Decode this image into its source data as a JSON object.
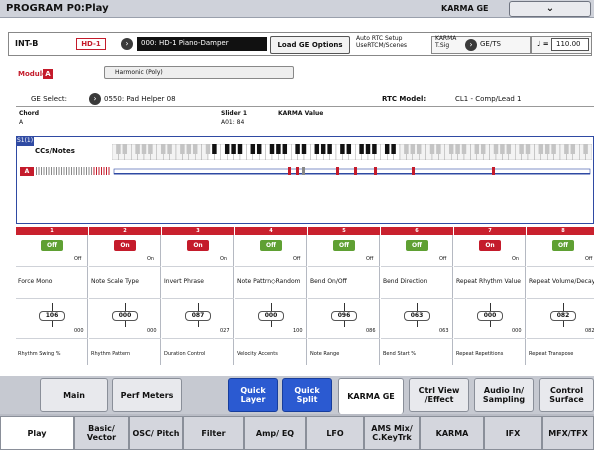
{
  "window": {
    "title": "PROGRAM P0:Play",
    "mode_label": "KARMA GE",
    "menu_icon": "chevron-down"
  },
  "program": {
    "bank": "INT-B",
    "number": "HD-1",
    "name": "000: HD-1 Piano-Damper",
    "load_ge_button": "Load GE Options",
    "rtc_setup_line1": "Auto RTC Setup",
    "rtc_setup_line2": "UseRTCM/Scenes",
    "karma_tsig_line1": "KARMA",
    "karma_tsig_line2": "T.Sig",
    "tsig_value": "GE/TS",
    "tempo_symbol": "♩ =",
    "tempo_value": "110.00"
  },
  "module": {
    "label": "Module",
    "id": "A",
    "harmonic": "Harmonic (Poly)",
    "ge_select_label": "GE Select:",
    "ge_value": "0550: Pad Helper 08",
    "rtc_model_label": "RTC Model:",
    "rtc_model_value": "CL1 - Comp/Lead 1",
    "chord_label": "Chord",
    "chord_value": "A",
    "slider_label": "Slider 1",
    "slider_value": "A01: 84",
    "karma_value_label": "KARMA Value"
  },
  "keyboard": {
    "tag": "S1(1)",
    "ccs_label": "CCs/Notes",
    "track_tag": "A"
  },
  "slots": [
    {
      "num": "1",
      "state": "Off",
      "state_text": "Off",
      "on": false,
      "switch_name": "Force Mono",
      "knob_value": "106",
      "knob_max": "000",
      "knob_name": "Rhythm Swing %"
    },
    {
      "num": "2",
      "state": "On",
      "state_text": "On",
      "on": true,
      "switch_name": "Note Scale Type",
      "knob_value": "000",
      "knob_max": "000",
      "knob_name": "Rhythm Pattern"
    },
    {
      "num": "3",
      "state": "On",
      "state_text": "On",
      "on": true,
      "switch_name": "Invert Phrase",
      "knob_value": "087",
      "knob_max": "027",
      "knob_name": "Duration Control"
    },
    {
      "num": "4",
      "state": "Off",
      "state_text": "Off",
      "on": false,
      "switch_name": "Note Pattrn◇Random",
      "knob_value": "000",
      "knob_max": "100",
      "knob_name": "Velocity Accents"
    },
    {
      "num": "5",
      "state": "Off",
      "state_text": "Off",
      "on": false,
      "switch_name": "Bend On/Off",
      "knob_value": "096",
      "knob_max": "086",
      "knob_name": "Note Range"
    },
    {
      "num": "6",
      "state": "Off",
      "state_text": "Off",
      "on": false,
      "switch_name": "Bend Direction",
      "knob_value": "063",
      "knob_max": "063",
      "knob_name": "Bend Start %"
    },
    {
      "num": "7",
      "state": "On",
      "state_text": "On",
      "on": true,
      "switch_name": "Repeat Rhythm Value",
      "knob_value": "000",
      "knob_max": "000",
      "knob_name": "Repeat Repetitions"
    },
    {
      "num": "8",
      "state": "Off",
      "state_text": "Off",
      "on": false,
      "switch_name": "Repeat Volume/Decay",
      "knob_value": "082",
      "knob_max": "082",
      "knob_name": "Repeat Transpose"
    }
  ],
  "tabs_top": [
    "Main",
    "Perf Meters",
    "Quick Layer",
    "Quick Split",
    "KARMA GE",
    "Ctrl View /Effect",
    "Audio In/ Sampling",
    "Control Surface"
  ],
  "tabs_bottom": [
    "Play",
    "Basic/ Vector",
    "OSC/ Pitch",
    "Filter",
    "Amp/ EQ",
    "LFO",
    "AMS Mix/ C.KeyTrk",
    "KARMA",
    "IFX",
    "MFX/TFX"
  ],
  "colors": {
    "accent_red": "#c41b2b",
    "accent_blue": "#2b5ad1",
    "on_green": "#5fa033"
  }
}
